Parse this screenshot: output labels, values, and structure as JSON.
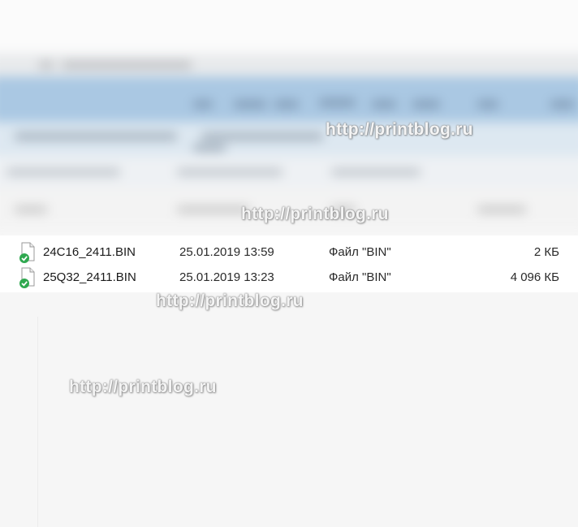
{
  "files": [
    {
      "name": "24C16_2411.BIN",
      "date": "25.01.2019 13:59",
      "type": "Файл \"BIN\"",
      "size": "2 КБ",
      "icon": "bin-file-synced-icon"
    },
    {
      "name": "25Q32_2411.BIN",
      "date": "25.01.2019 13:23",
      "type": "Файл \"BIN\"",
      "size": "4 096 КБ",
      "icon": "bin-file-synced-icon"
    }
  ],
  "watermark": "http://printblog.ru",
  "colors": {
    "ribbon": "#aac8e3",
    "sync_badge": "#2fa84f",
    "text": "#1a1a1a"
  }
}
